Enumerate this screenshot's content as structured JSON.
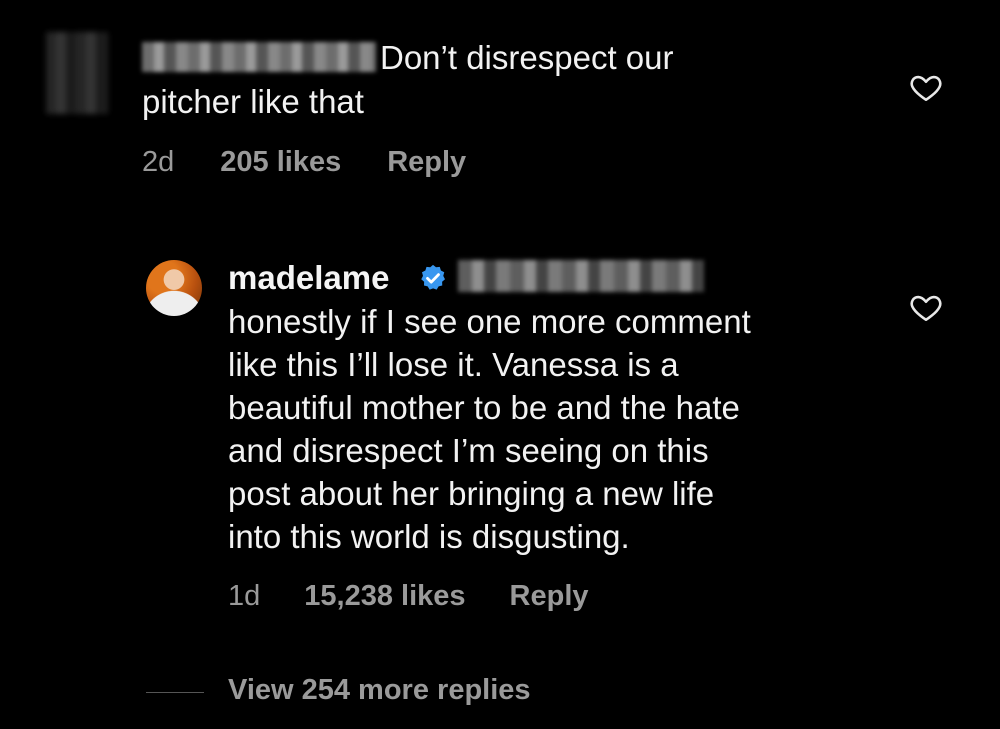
{
  "comment1": {
    "username_redacted": true,
    "text_line1": "Don’t disrespect our",
    "text_line2": "pitcher like that",
    "time": "2d",
    "likes": "205 likes",
    "reply": "Reply",
    "icon": "heart-icon"
  },
  "comment2": {
    "username": "madelame",
    "verified_icon": "verified-badge-icon",
    "mention_redacted": true,
    "body": "honestly if I see one more comment\nlike this I’ll lose it. Vanessa is a\nbeautiful mother to be and the hate\nand disrespect I’m seeing on this\npost about her bringing a new life\ninto this world is disgusting.",
    "time": "1d",
    "likes": "15,238 likes",
    "reply": "Reply",
    "icon": "heart-icon"
  },
  "view_more": {
    "label": "View 254 more replies"
  },
  "colors": {
    "background": "#000000",
    "text": "#f2f2f2",
    "meta": "#9a9a9a",
    "verified": "#3897f0"
  }
}
